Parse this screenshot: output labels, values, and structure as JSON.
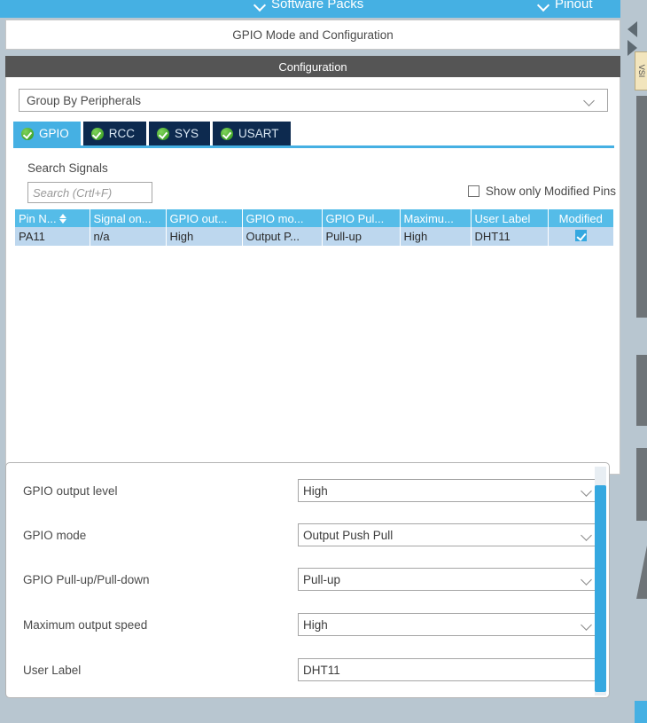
{
  "topbar": {
    "software_packs": "Software Packs",
    "pinout": "Pinout"
  },
  "panel": {
    "title": "GPIO Mode and Configuration",
    "section_header": "Configuration"
  },
  "group_select": {
    "value": "Group By Peripherals"
  },
  "tabs": [
    {
      "label": "GPIO",
      "active": true
    },
    {
      "label": "RCC",
      "active": false
    },
    {
      "label": "SYS",
      "active": false
    },
    {
      "label": "USART",
      "active": false
    }
  ],
  "search": {
    "label": "Search Signals",
    "value": "",
    "placeholder": "Search (Crtl+F)"
  },
  "modified_filter": {
    "label": "Show only Modified Pins",
    "checked": false
  },
  "table": {
    "columns": [
      "Pin N...",
      "Signal on...",
      "GPIO out...",
      "GPIO mo...",
      "GPIO Pul...",
      "Maximu...",
      "User Label",
      "Modified"
    ],
    "rows": [
      {
        "pin_name": "PA11",
        "signal_on_pin": "n/a",
        "gpio_output_level": "High",
        "gpio_mode": "Output P...",
        "gpio_pull": "Pull-up",
        "maximum_speed": "High",
        "user_label": "DHT11",
        "modified": true
      }
    ]
  },
  "properties": [
    {
      "label": "GPIO output level",
      "value": "High",
      "control": "dropdown"
    },
    {
      "label": "GPIO mode",
      "value": "Output Push Pull",
      "control": "dropdown"
    },
    {
      "label": "GPIO Pull-up/Pull-down",
      "value": "Pull-up",
      "control": "dropdown"
    },
    {
      "label": "Maximum output speed",
      "value": "High",
      "control": "dropdown"
    },
    {
      "label": "User Label",
      "value": "DHT11",
      "control": "text"
    }
  ],
  "side_tab": {
    "label": "VSI"
  },
  "colors": {
    "accent_blue": "#45b0e3",
    "tab_inactive": "#0d2a4f",
    "header_gray": "#555555",
    "table_header": "#55bce8",
    "table_row": "#bdd7ee",
    "chrome": "#b8c6d0"
  }
}
